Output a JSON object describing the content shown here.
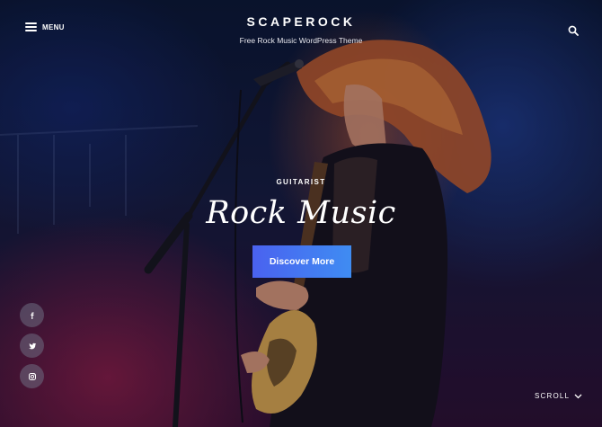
{
  "header": {
    "menu_label": "MENU",
    "site_title": "SCAPEROCK",
    "tagline": "Free Rock Music WordPress Theme"
  },
  "hero": {
    "eyebrow": "GUITARIST",
    "headline": "Rock Music",
    "cta_label": "Discover More"
  },
  "social": [
    {
      "icon": "facebook-icon"
    },
    {
      "icon": "twitter-icon"
    },
    {
      "icon": "instagram-icon"
    }
  ],
  "scroll_label": "SCROLL",
  "colors": {
    "cta_start": "#4a62f0",
    "cta_end": "#3f8cf2",
    "text": "#ffffff"
  }
}
